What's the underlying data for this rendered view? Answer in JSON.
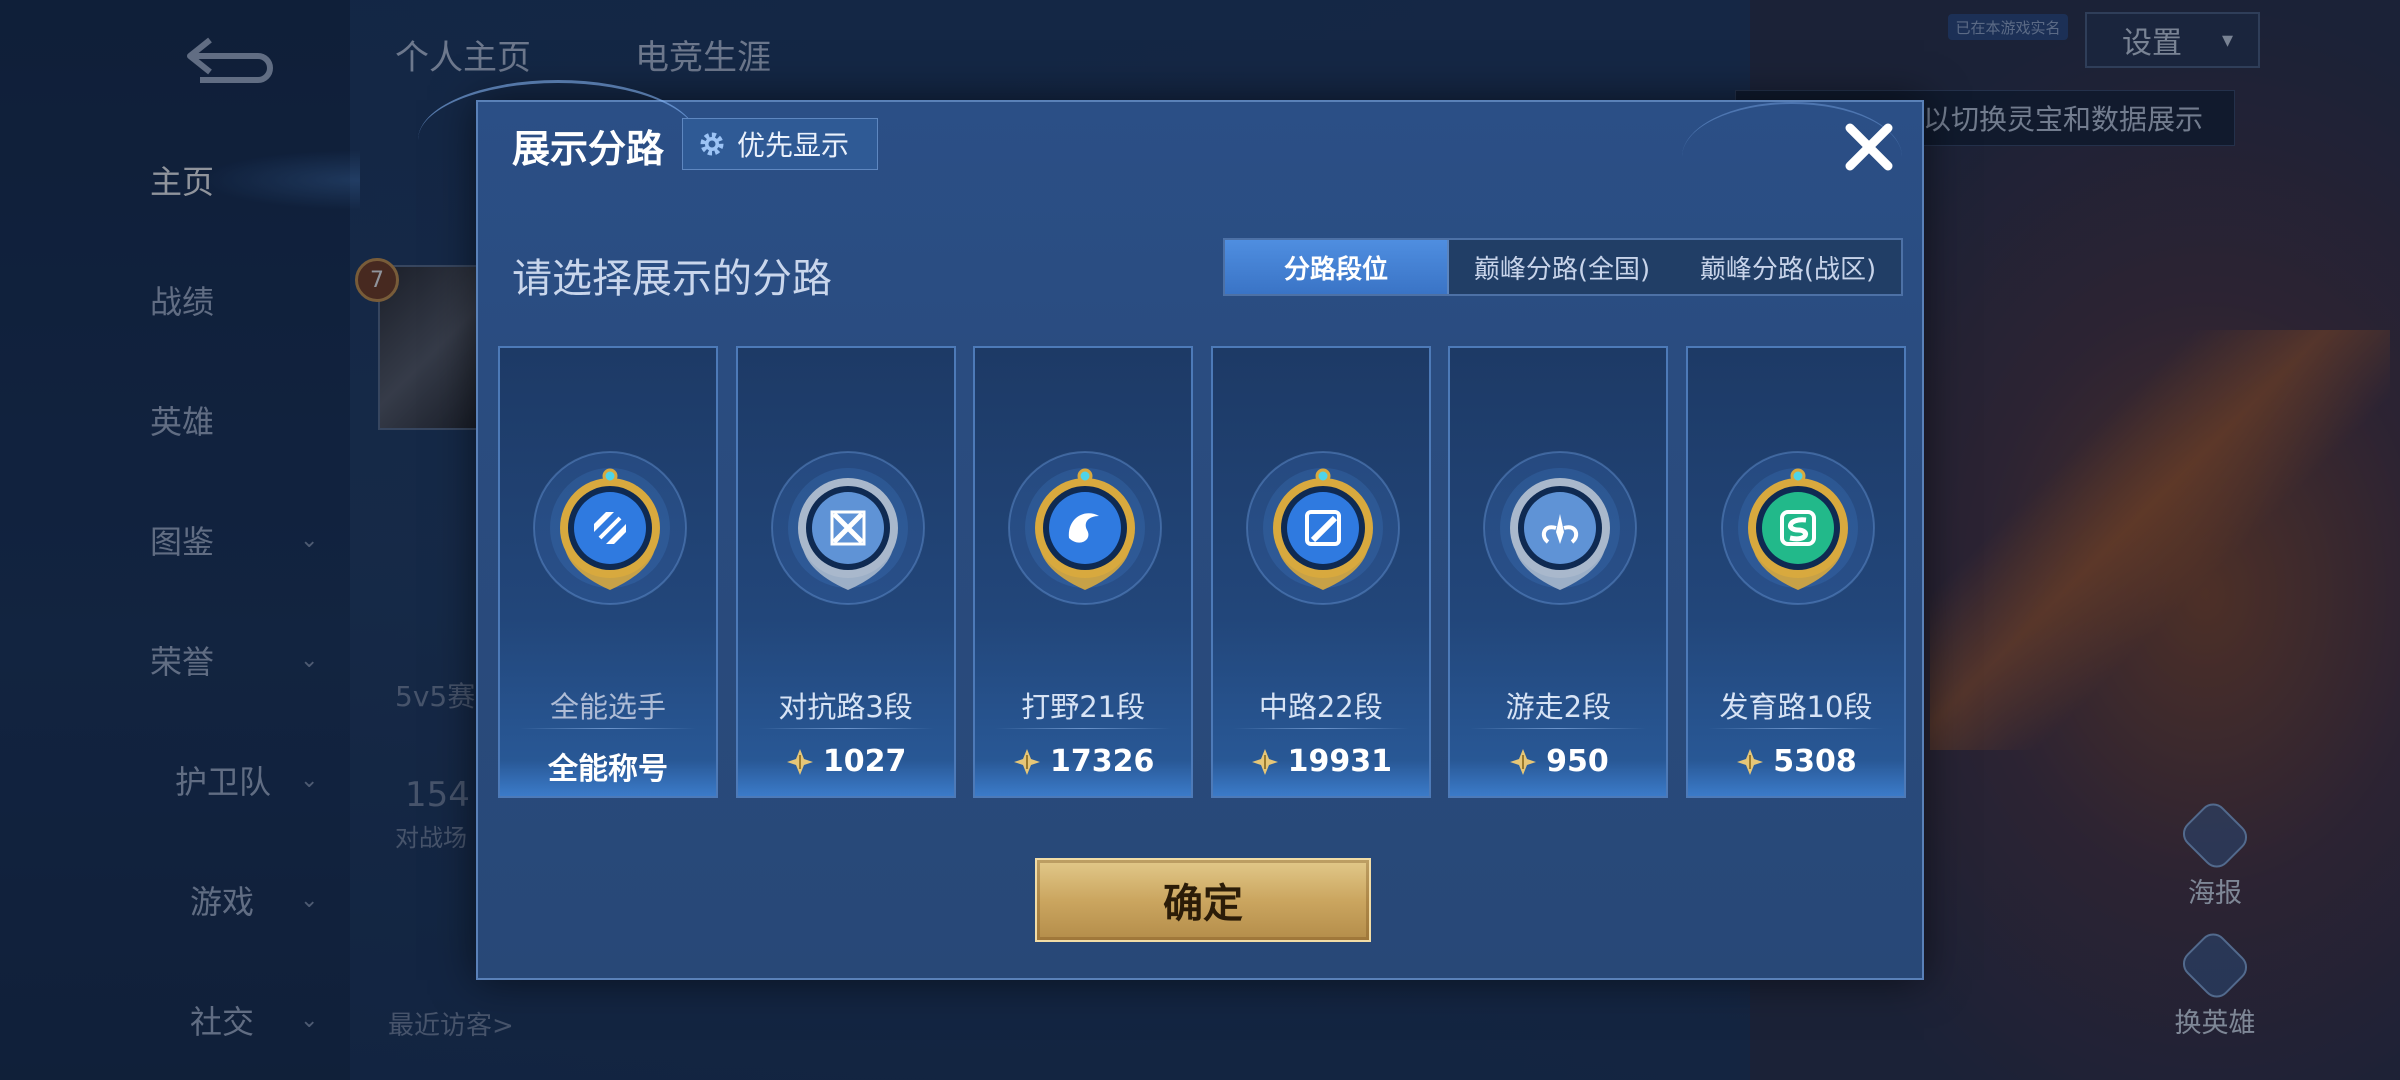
{
  "nav": {
    "items": [
      {
        "label": "主页",
        "chevron": false,
        "active": true
      },
      {
        "label": "战绩",
        "chevron": false
      },
      {
        "label": "英雄",
        "chevron": false
      },
      {
        "label": "图鉴",
        "chevron": true
      },
      {
        "label": "荣誉",
        "chevron": true
      },
      {
        "label": "护卫队",
        "chevron": true
      },
      {
        "label": "游戏",
        "chevron": true
      },
      {
        "label": "社交",
        "chevron": true
      }
    ]
  },
  "background": {
    "tabs": [
      "个人主页",
      "电竞生涯"
    ],
    "level": "7",
    "faded_texts": [
      "5v5赛",
      "154",
      "对战场",
      "最近访客>"
    ],
    "settings_label": "设置",
    "settings_tag": "已在本游戏实名",
    "hint": "以切换灵宝和数据展示",
    "side_buttons": [
      "海报",
      "换英雄"
    ]
  },
  "modal": {
    "title": "展示分路",
    "priority_label": "优先显示",
    "subtitle": "请选择展示的分路",
    "tabs": [
      "分路段位",
      "巅峰分路(全国)",
      "巅峰分路(战区)"
    ],
    "active_tab": 0,
    "confirm_label": "确定",
    "cards": [
      {
        "name": "全能选手",
        "score": "全能称号",
        "show_icon": false,
        "emblem": "gold",
        "glyph": "allround"
      },
      {
        "name": "对抗路3段",
        "score": "1027",
        "show_icon": true,
        "emblem": "silver",
        "glyph": "sword"
      },
      {
        "name": "打野21段",
        "score": "17326",
        "show_icon": true,
        "emblem": "gold",
        "glyph": "dragon"
      },
      {
        "name": "中路22段",
        "score": "19931",
        "show_icon": true,
        "emblem": "gold",
        "glyph": "staff"
      },
      {
        "name": "游走2段",
        "score": "950",
        "show_icon": true,
        "emblem": "silver",
        "glyph": "wings"
      },
      {
        "name": "发育路10段",
        "score": "5308",
        "show_icon": true,
        "emblem": "gold-green",
        "glyph": "arrow"
      }
    ]
  },
  "colors": {
    "modal_bg": "#2a4c80",
    "tab_active": "#4f8ee0",
    "confirm_gold": "#cba660",
    "emblem_gold": "#d8a93e",
    "emblem_silver": "#a9b8cc",
    "emblem_blue": "#2f7ae0",
    "emblem_green": "#22b98a"
  }
}
